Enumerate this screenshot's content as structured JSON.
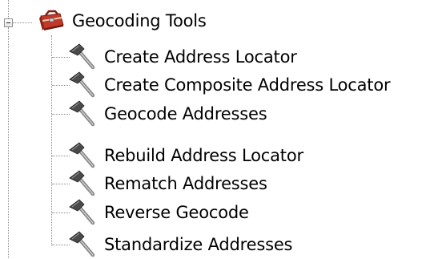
{
  "toolbox": {
    "label": "Geocoding Tools",
    "icon": "toolbox-icon",
    "expanded": true,
    "tools": [
      {
        "label": "Create Address Locator",
        "icon": "hammer-icon"
      },
      {
        "label": "Create Composite Address Locator",
        "icon": "hammer-icon"
      },
      {
        "label": "Geocode Addresses",
        "icon": "hammer-icon"
      },
      {
        "label": "Rebuild Address Locator",
        "icon": "hammer-icon"
      },
      {
        "label": "Rematch Addresses",
        "icon": "hammer-icon"
      },
      {
        "label": "Reverse Geocode",
        "icon": "hammer-icon"
      },
      {
        "label": "Standardize Addresses",
        "icon": "hammer-icon"
      }
    ]
  },
  "colors": {
    "connector": "#8c8c8c",
    "toolbox_red": "#c0392b",
    "hammer_head": "#4a4a4a",
    "hammer_handle": "#8a8a8a"
  }
}
